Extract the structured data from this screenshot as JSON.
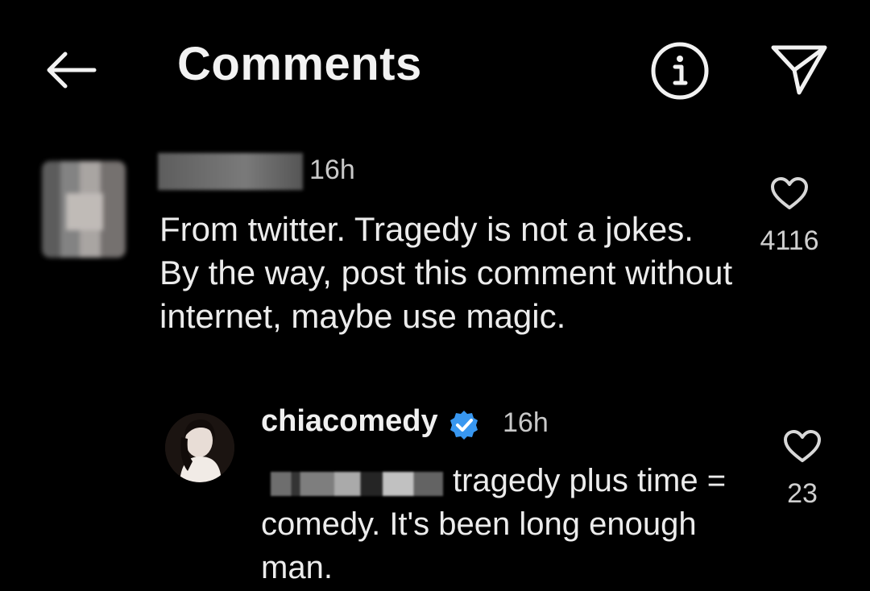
{
  "header": {
    "title": "Comments",
    "back_icon": "arrow-left-icon",
    "info_icon": "info-circle-icon",
    "share_icon": "paper-plane-icon"
  },
  "comments": [
    {
      "username": "",
      "time": "16h",
      "text": "From twitter. Tragedy is not a jokes. By the way, post this comment without internet, maybe use magic.",
      "likes": "4116"
    },
    {
      "username": "chiacomedy",
      "verified": true,
      "time": "16h",
      "text": "tragedy plus time = comedy. It's been long enough man.",
      "likes": "23"
    }
  ],
  "colors": {
    "background": "#000000",
    "verified_badge": "#3897f0",
    "text": "#ececec"
  }
}
